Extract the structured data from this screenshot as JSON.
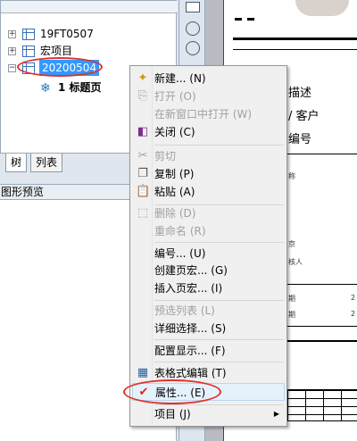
{
  "tree": {
    "items": [
      {
        "label": "19FT0507"
      },
      {
        "label": "宏项目"
      },
      {
        "label": "20200504"
      },
      {
        "label": "1 标题页"
      }
    ]
  },
  "tabs": [
    {
      "label": "树"
    },
    {
      "label": "列表"
    }
  ],
  "preview": {
    "title": "图形预览"
  },
  "sheet": {
    "lines": [
      "描述",
      "/ 客户",
      "编号"
    ],
    "small": [
      "称",
      "京",
      "核人",
      "期",
      "期",
      "2",
      "2"
    ]
  },
  "menu": {
    "items": [
      {
        "label": "新建... (N)",
        "icon": "new-icon",
        "disabled": false
      },
      {
        "label": "打开 (O)",
        "icon": "open-icon",
        "disabled": true
      },
      {
        "label": "在新窗口中打开 (W)",
        "icon": "",
        "disabled": true
      },
      {
        "label": "关闭 (C)",
        "icon": "close-doc-icon",
        "disabled": false
      },
      {
        "label": "剪切",
        "icon": "cut-icon",
        "disabled": true
      },
      {
        "label": "复制 (P)",
        "icon": "copy-icon",
        "disabled": false
      },
      {
        "label": "粘贴 (A)",
        "icon": "paste-icon",
        "disabled": false
      },
      {
        "label": "删除 (D)",
        "icon": "delete-icon",
        "disabled": true
      },
      {
        "label": "重命名 (R)",
        "icon": "",
        "disabled": true
      },
      {
        "label": "编号... (U)",
        "icon": "",
        "disabled": false
      },
      {
        "label": "创建页宏... (G)",
        "icon": "",
        "disabled": false
      },
      {
        "label": "插入页宏... (I)",
        "icon": "",
        "disabled": false
      },
      {
        "label": "预选列表 (L)",
        "icon": "",
        "disabled": true
      },
      {
        "label": "详细选择... (S)",
        "icon": "",
        "disabled": false
      },
      {
        "label": "配置显示... (F)",
        "icon": "",
        "disabled": false
      },
      {
        "label": "表格式编辑 (T)",
        "icon": "table-edit-icon",
        "disabled": false
      },
      {
        "label": "属性... (E)",
        "icon": "properties-icon",
        "disabled": false
      },
      {
        "label": "项目 (J)",
        "icon": "",
        "disabled": false
      }
    ]
  },
  "colors": {
    "highlight": "#e0312b",
    "selection": "#3399ff"
  }
}
